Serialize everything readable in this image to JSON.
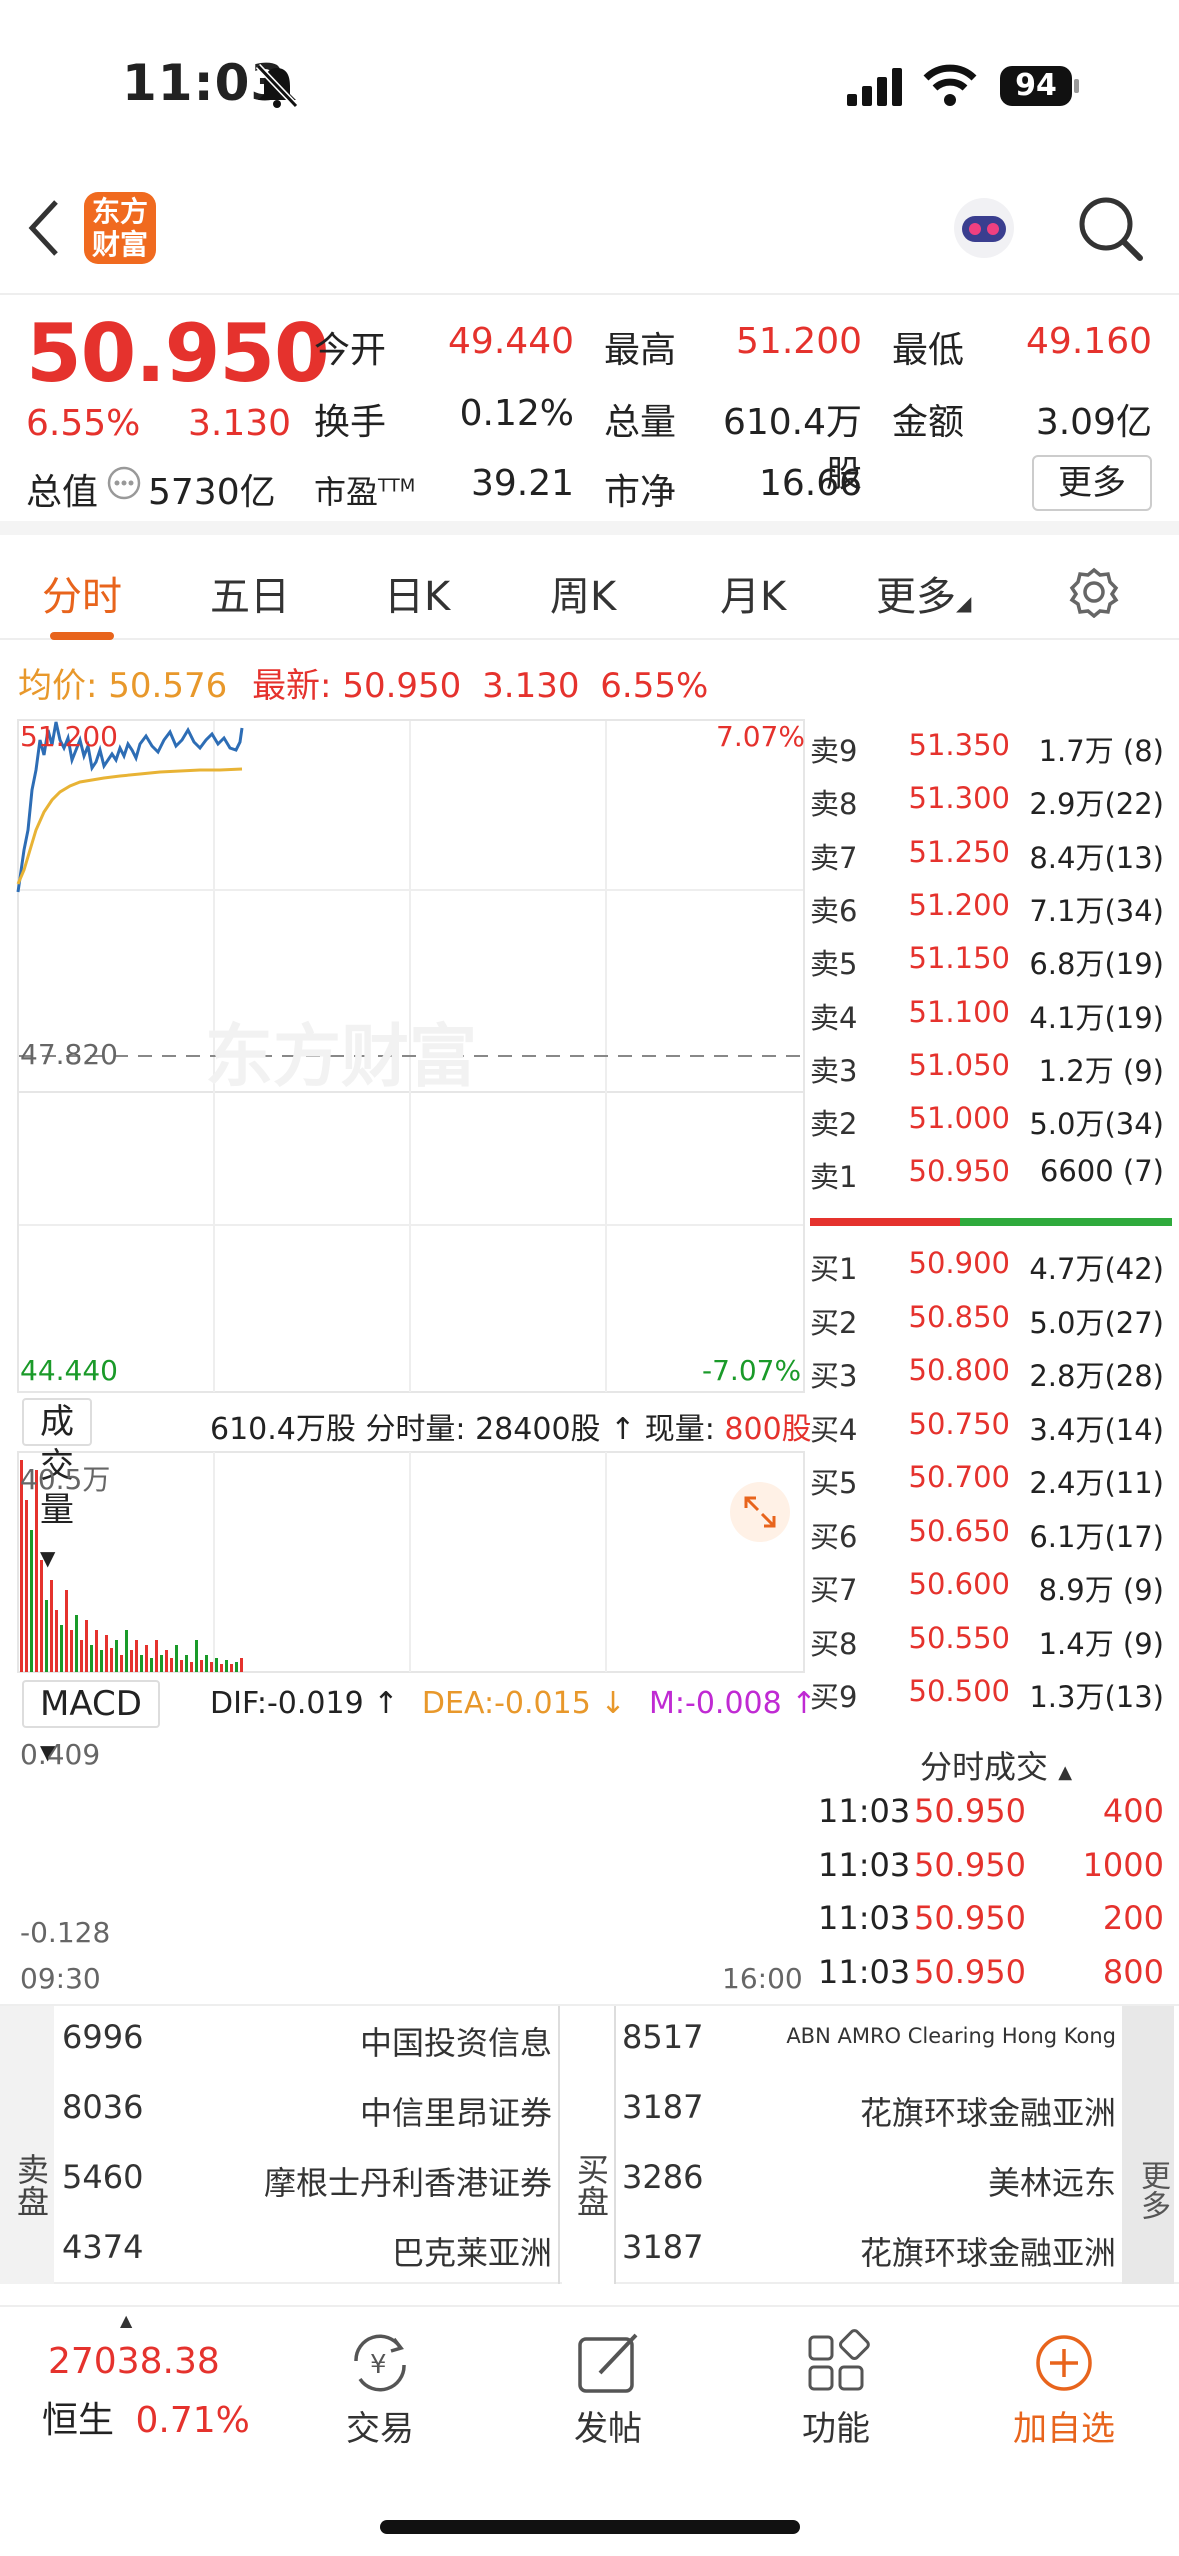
{
  "status_bar": {
    "time": "11:03",
    "battery": "94"
  },
  "header": {
    "logo_text": "东方财富"
  },
  "quote": {
    "price": "50.950",
    "change_pct": "6.55%",
    "change": "3.130",
    "open_label": "今开",
    "open": "49.440",
    "high_label": "最高",
    "high": "51.200",
    "low_label": "最低",
    "low": "49.160",
    "turnover_label": "换手",
    "turnover": "0.12%",
    "volume_label": "总量",
    "volume": "610.4万股",
    "amount_label": "金额",
    "amount": "3.09亿",
    "mktcap_label": "总值",
    "mktcap": "5730亿",
    "pe_label": "市盈",
    "pe_sup": "TTM",
    "pe": "39.21",
    "pb_label": "市净",
    "pb": "16.66",
    "more": "更多"
  },
  "tabs": [
    "分时",
    "五日",
    "日K",
    "周K",
    "月K",
    "更多"
  ],
  "avg_row": {
    "avg_label": "均价:",
    "avg": "50.576",
    "latest_label": "最新:",
    "latest": "50.950",
    "chg": "3.130",
    "pct": "6.55%"
  },
  "chart": {
    "y_high": "51.200",
    "y_mid": "47.820",
    "y_low": "44.440",
    "pct_high": "7.07%",
    "pct_low": "-7.07%",
    "x_start": "09:30",
    "x_end": "16:00",
    "watermark": "东方财富"
  },
  "volume_header": {
    "selector": "成交量",
    "total": "610.4万股",
    "period_label": "分时量:",
    "period": "28400股",
    "now_label": "现量:",
    "now": "800股",
    "ymax": "40.5万"
  },
  "macd_header": {
    "selector": "MACD",
    "dif": "DIF:-0.019 ↑",
    "dea": "DEA:-0.015 ↓",
    "m": "M:-0.008 ↑",
    "ymax": "0.409",
    "ymin": "-0.128"
  },
  "order_book": {
    "asks": [
      {
        "label": "卖9",
        "price": "51.350",
        "vol": "1.7万 (8)"
      },
      {
        "label": "卖8",
        "price": "51.300",
        "vol": "2.9万(22)"
      },
      {
        "label": "卖7",
        "price": "51.250",
        "vol": "8.4万(13)"
      },
      {
        "label": "卖6",
        "price": "51.200",
        "vol": "7.1万(34)"
      },
      {
        "label": "卖5",
        "price": "51.150",
        "vol": "6.8万(19)"
      },
      {
        "label": "卖4",
        "price": "51.100",
        "vol": "4.1万(19)"
      },
      {
        "label": "卖3",
        "price": "51.050",
        "vol": "1.2万 (9)"
      },
      {
        "label": "卖2",
        "price": "51.000",
        "vol": "5.0万(34)"
      },
      {
        "label": "卖1",
        "price": "50.950",
        "vol": "6600 (7)"
      }
    ],
    "bids": [
      {
        "label": "买1",
        "price": "50.900",
        "vol": "4.7万(42)"
      },
      {
        "label": "买2",
        "price": "50.850",
        "vol": "5.0万(27)"
      },
      {
        "label": "买3",
        "price": "50.800",
        "vol": "2.8万(28)"
      },
      {
        "label": "买4",
        "price": "50.750",
        "vol": "3.4万(14)"
      },
      {
        "label": "买5",
        "price": "50.700",
        "vol": "2.4万(11)"
      },
      {
        "label": "买6",
        "price": "50.650",
        "vol": "6.1万(17)"
      },
      {
        "label": "买7",
        "price": "50.600",
        "vol": "8.9万 (9)"
      },
      {
        "label": "买8",
        "price": "50.550",
        "vol": "1.4万 (9)"
      },
      {
        "label": "买9",
        "price": "50.500",
        "vol": "1.3万(13)"
      }
    ]
  },
  "trades": {
    "title": "分时成交",
    "rows": [
      {
        "time": "11:03",
        "price": "50.950",
        "vol": "400"
      },
      {
        "time": "11:03",
        "price": "50.950",
        "vol": "1000"
      },
      {
        "time": "11:03",
        "price": "50.950",
        "vol": "200"
      },
      {
        "time": "11:03",
        "price": "50.950",
        "vol": "800"
      }
    ]
  },
  "broker_queue": {
    "sell_label": "卖盘",
    "buy_label": "买盘",
    "more": "更多",
    "sell": [
      {
        "code": "6996",
        "name": "中国投资信息"
      },
      {
        "code": "8036",
        "name": "中信里昂证券"
      },
      {
        "code": "5460",
        "name": "摩根士丹利香港证券"
      },
      {
        "code": "4374",
        "name": "巴克莱亚洲"
      }
    ],
    "buy": [
      {
        "code": "8517",
        "name": "ABN AMRO Clearing Hong Kong"
      },
      {
        "code": "3187",
        "name": "花旗环球金融亚洲"
      },
      {
        "code": "3286",
        "name": "美林远东"
      },
      {
        "code": "3187",
        "name": "花旗环球金融亚洲"
      }
    ]
  },
  "bottom_bar": {
    "index_value": "27038.38",
    "index_name": "恒生",
    "index_pct": "0.71%",
    "trade": "交易",
    "post": "发帖",
    "functions": "功能",
    "add_watch": "加自选"
  }
}
